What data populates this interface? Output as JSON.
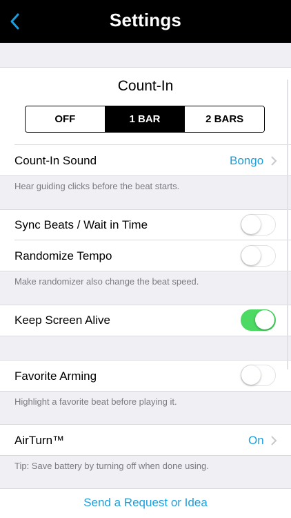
{
  "nav": {
    "title": "Settings"
  },
  "count_in": {
    "title": "Count-In",
    "segments": [
      "OFF",
      "1 BAR",
      "2 BARS"
    ],
    "selected": "1 BAR"
  },
  "count_in_sound": {
    "label": "Count-In Sound",
    "value": "Bongo",
    "footnote": "Hear guiding clicks before the beat starts."
  },
  "sync_beats": {
    "label": "Sync Beats / Wait in Time",
    "on": false
  },
  "randomize_tempo": {
    "label": "Randomize Tempo",
    "on": false,
    "footnote": "Make randomizer also change the beat speed."
  },
  "keep_screen_alive": {
    "label": "Keep Screen Alive",
    "on": true
  },
  "favorite_arming": {
    "label": "Favorite Arming",
    "on": false,
    "footnote": "Highlight a favorite beat before playing it."
  },
  "airturn": {
    "label": "AirTurn™",
    "value": "On",
    "footnote": "Tip: Save battery by turning off when done using."
  },
  "request_link": "Send a Request or Idea",
  "colors": {
    "accent": "#1a9fde",
    "toggle_on": "#4cd964",
    "nav_bg": "#000000"
  }
}
